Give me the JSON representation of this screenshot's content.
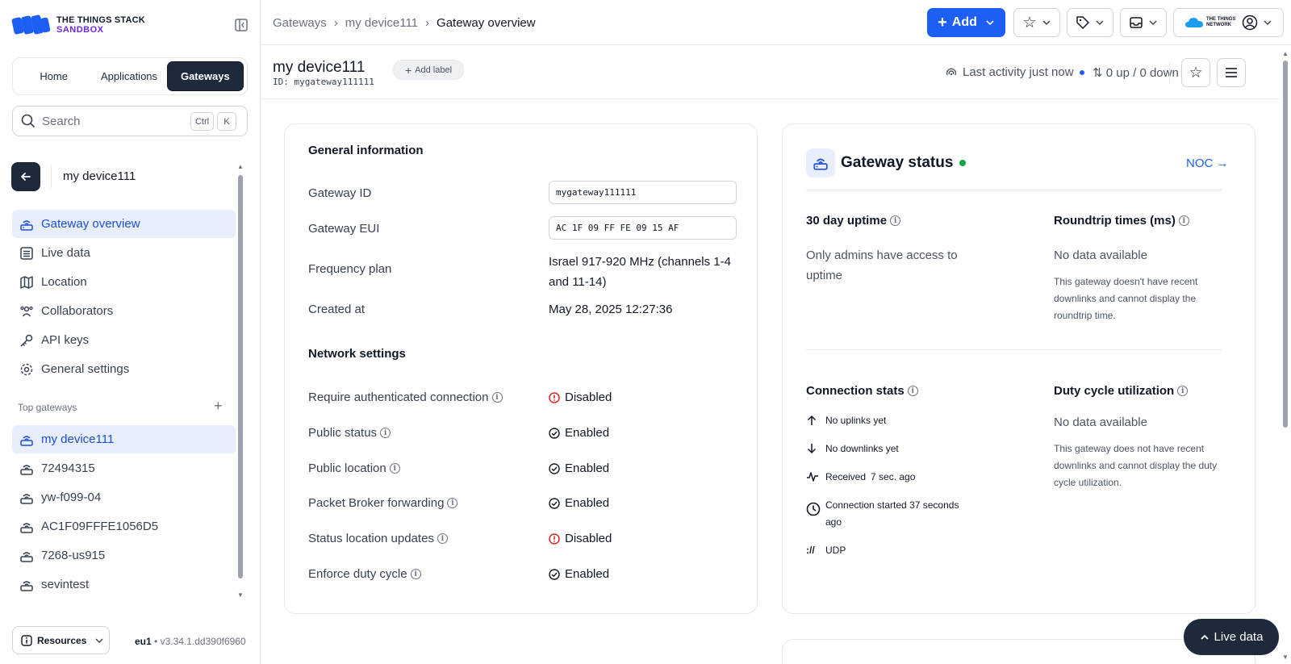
{
  "logo": {
    "line1": "THE THINGS STACK",
    "line2": "SANDBOX"
  },
  "tabs": [
    {
      "label": "Home",
      "active": false
    },
    {
      "label": "Applications",
      "active": false
    },
    {
      "label": "Gateways",
      "active": true
    }
  ],
  "search": {
    "placeholder": "Search",
    "kbd1": "Ctrl",
    "kbd2": "K"
  },
  "device": {
    "name": "my device111"
  },
  "nav": [
    {
      "label": "Gateway overview",
      "icon": "gateway-icon",
      "active": true
    },
    {
      "label": "Live data",
      "icon": "list-icon",
      "active": false
    },
    {
      "label": "Location",
      "icon": "map-icon",
      "active": false
    },
    {
      "label": "Collaborators",
      "icon": "users-icon",
      "active": false
    },
    {
      "label": "API keys",
      "icon": "key-icon",
      "active": false
    },
    {
      "label": "General settings",
      "icon": "gear-icon",
      "active": false
    }
  ],
  "top_gateways": {
    "title": "Top gateways",
    "items": [
      "my device111",
      "72494315",
      "yw-f099-04",
      "AC1F09FFFE1056D5",
      "7268-us915",
      "sevintest"
    ]
  },
  "footer": {
    "resources": "Resources",
    "region": "eu1",
    "version": "v3.34.1.dd390f6960"
  },
  "topbar": {
    "crumbs": [
      "Gateways",
      "my device111",
      "Gateway overview"
    ],
    "add_label": "Add",
    "brand": "THE THINGS NETWORK"
  },
  "header": {
    "title": "my device111",
    "id_text": "ID: mygateway111111",
    "add_label": "Add label",
    "activity": "Last activity just now",
    "updown": "0 up / 0 down"
  },
  "general": {
    "title": "General information",
    "gateway_id_label": "Gateway ID",
    "gateway_id": "mygateway111111",
    "gateway_eui_label": "Gateway EUI",
    "gateway_eui": "AC 1F 09 FF FE 09 15 AF",
    "freq_label": "Frequency plan",
    "freq_line1": "Israel 917-920 MHz (channels 1-4",
    "freq_line2": "and 11-14)",
    "created_label": "Created at",
    "created": "May 28, 2025 12:27:36"
  },
  "network": {
    "title": "Network settings",
    "rows": [
      {
        "label": "Require authenticated connection",
        "value": "Disabled",
        "enabled": false
      },
      {
        "label": "Public status",
        "value": "Enabled",
        "enabled": true
      },
      {
        "label": "Public location",
        "value": "Enabled",
        "enabled": true
      },
      {
        "label": "Packet Broker forwarding",
        "value": "Enabled",
        "enabled": true
      },
      {
        "label": "Status location updates",
        "value": "Disabled",
        "enabled": false
      },
      {
        "label": "Enforce duty cycle",
        "value": "Enabled",
        "enabled": true
      }
    ]
  },
  "status": {
    "title": "Gateway status",
    "noc": "NOC →",
    "uptime_title": "30 day uptime",
    "uptime_line1": "Only admins have access to",
    "uptime_line2": "uptime",
    "rtt_title": "Roundtrip times (ms)",
    "rtt_value": "No data available",
    "rtt_desc1": "This gateway doesn't have recent",
    "rtt_desc2": "downlinks and cannot display the",
    "rtt_desc3": "roundtrip time.",
    "conn_title": "Connection stats",
    "uplinks": "No uplinks yet",
    "downlinks": "No downlinks yet",
    "received_label": "Received",
    "received_value": "7 sec. ago",
    "started_line1": "Connection started 37 seconds",
    "started_line2": "ago",
    "protocol": "UDP",
    "duty_title": "Duty cycle utilization",
    "duty_value": "No data available",
    "duty_desc1": "This gateway does not have recent",
    "duty_desc2": "downlinks and cannot display the duty",
    "duty_desc3": "cycle utilization."
  },
  "live_data": "Live data",
  "colors": {
    "accent": "#1d5ef5",
    "dark": "#1e293b",
    "brand_purple": "#6d28d9",
    "ok": "#16a34a",
    "error": "#dc2626"
  }
}
